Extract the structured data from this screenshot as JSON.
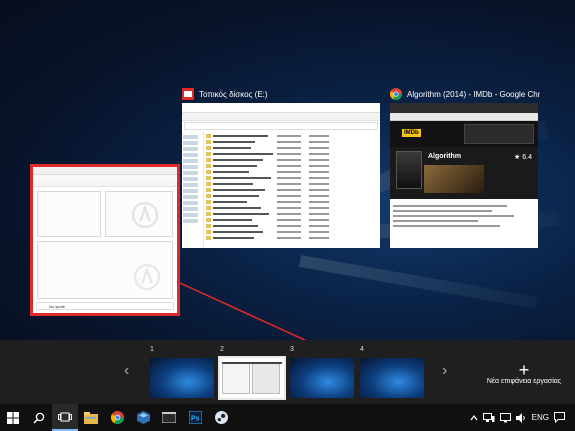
{
  "windows": {
    "explorer": {
      "title": "Τοπικός δίσκος (E:)",
      "icon": "drive-icon",
      "accent": "#e02a2a"
    },
    "chrome": {
      "title": "Algorithm (2014) - IMDb - Google Chr...",
      "icon": "chrome-icon",
      "page_title": "Algorithm",
      "rating": "★ 6.4"
    },
    "recorder": {
      "status": "No sprite"
    }
  },
  "virtual_desktops": {
    "desktops": [
      {
        "label": "1"
      },
      {
        "label": "2"
      },
      {
        "label": "3"
      },
      {
        "label": "4"
      }
    ],
    "active_index": 1,
    "new_desktop_label": "Νέα επιφάνεια εργασίας"
  },
  "taskbar": {
    "apps": [
      "start-icon",
      "search-icon",
      "task-view-icon",
      "file-explorer-icon",
      "chrome-icon",
      "virtualbox-icon",
      "terminal-icon",
      "photoshop-icon",
      "steam-icon"
    ],
    "tray": {
      "language": "ENG"
    }
  },
  "colors": {
    "highlight": "#e02a2a",
    "taskbar": "#101010",
    "strip": "#1f1f1f"
  }
}
